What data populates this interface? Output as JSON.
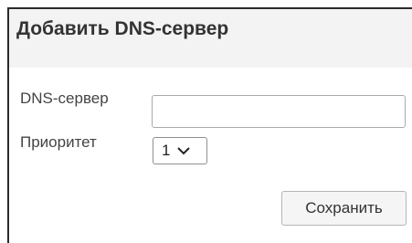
{
  "dialog": {
    "title": "Добавить DNS-сервер"
  },
  "form": {
    "dns_label": "DNS-сервер",
    "dns_value": "",
    "priority_label": "Приоритет",
    "priority_selected": "1",
    "save_label": "Сохранить"
  },
  "icons": {
    "priority_dropdown": "chevron-down-icon"
  },
  "colors": {
    "title_bar": "#f3f3f3",
    "text": "#333333",
    "border": "#a9a9a9"
  }
}
